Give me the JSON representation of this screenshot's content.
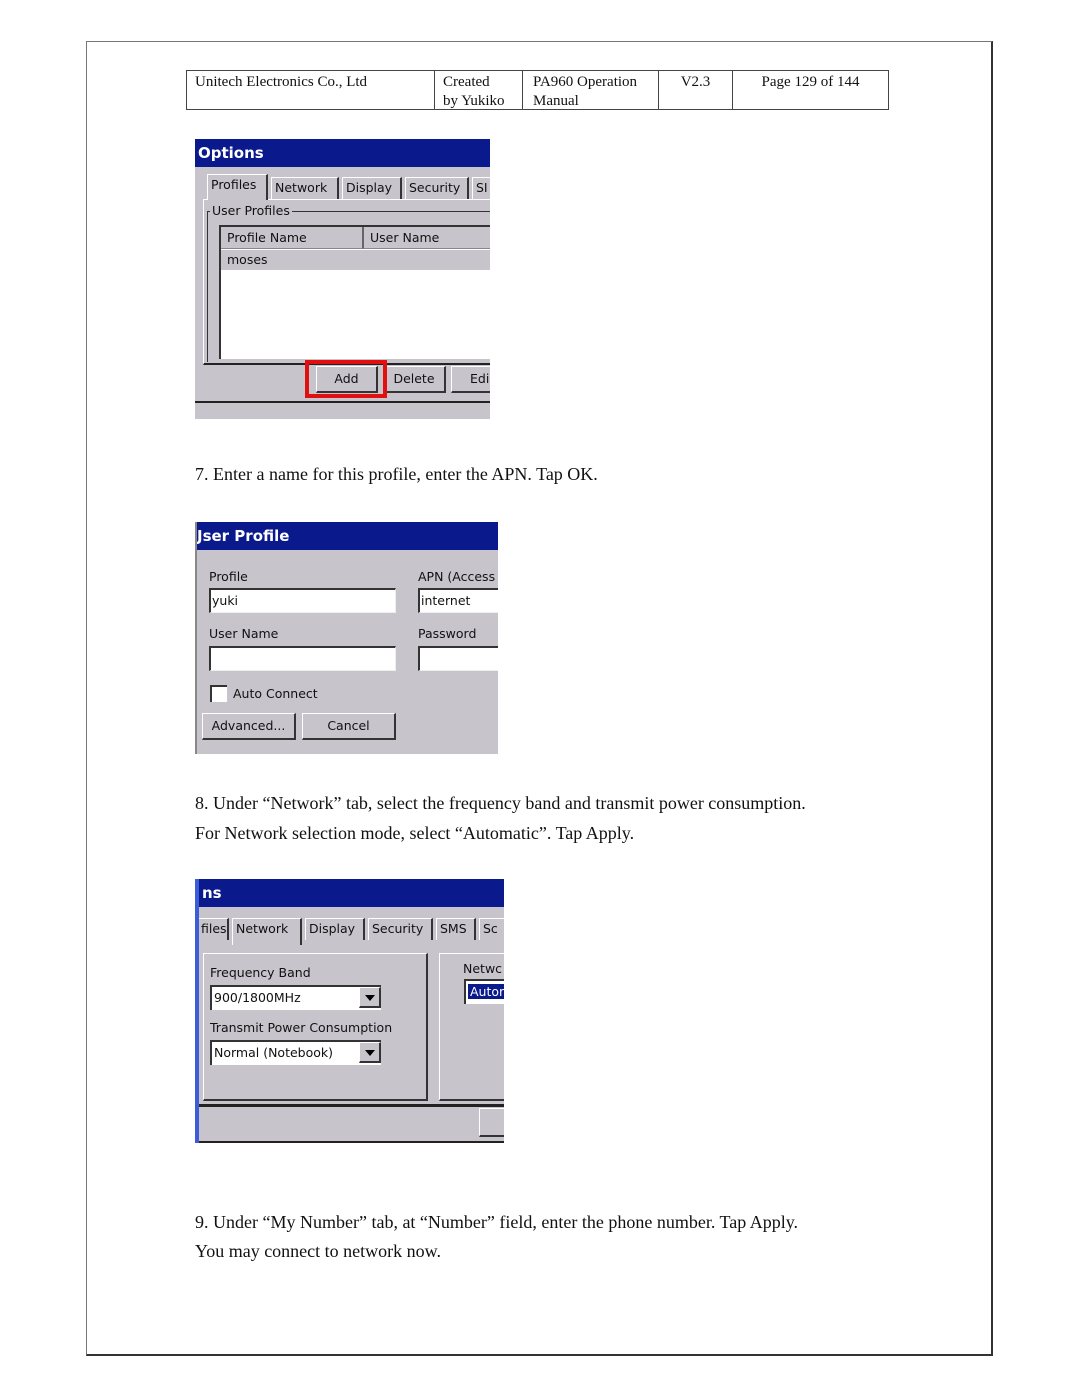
{
  "header": {
    "company": "Unitech Electronics Co., Ltd",
    "created_line1": "Created",
    "created_line2": "by Yukiko",
    "doc_line1": "PA960 Operation",
    "doc_line2": "Manual",
    "version": "V2.3",
    "page": "Page 129 of 144"
  },
  "shot1": {
    "title": "Options",
    "tabs": [
      "Profiles",
      "Network",
      "Display",
      "Security",
      "SI"
    ],
    "group_label": "User Profiles",
    "columns": [
      "Profile Name",
      "User Name"
    ],
    "rows": [
      [
        "moses",
        ""
      ]
    ],
    "buttons": [
      "Add",
      "Delete",
      "Edi"
    ],
    "highlight_color": "#e01010"
  },
  "step7": "7. Enter a name for this profile, enter the APN. Tap OK.",
  "shot2": {
    "title": "Jser Profile",
    "profile_label": "Profile",
    "profile_value": "yuki",
    "apn_label": "APN (Access",
    "apn_value": "internet",
    "username_label": "User Name",
    "username_value": "",
    "password_label": "Password",
    "password_value": "",
    "auto_connect_label": "Auto Connect",
    "auto_connect_checked": false,
    "advanced_button": "Advanced...",
    "cancel_button": "Cancel"
  },
  "step8_line1": "8. Under “Network” tab, select the frequency band and transmit power consumption.",
  "step8_line2": "For Network selection mode, select “Automatic”. Tap Apply.",
  "shot3": {
    "title": "ns",
    "tabs": [
      "files",
      "Network",
      "Display",
      "Security",
      "SMS",
      "Sc"
    ],
    "freq_label": "Frequency Band",
    "freq_value": "900/1800MHz",
    "power_label": "Transmit Power Consumption",
    "power_value": "Normal (Notebook)",
    "network_label": "Netwc",
    "network_value": "Autor"
  },
  "step9_line1": "9. Under “My Number” tab, at “Number” field, enter the phone number. Tap Apply.",
  "step9_line2": "You may connect to network now."
}
